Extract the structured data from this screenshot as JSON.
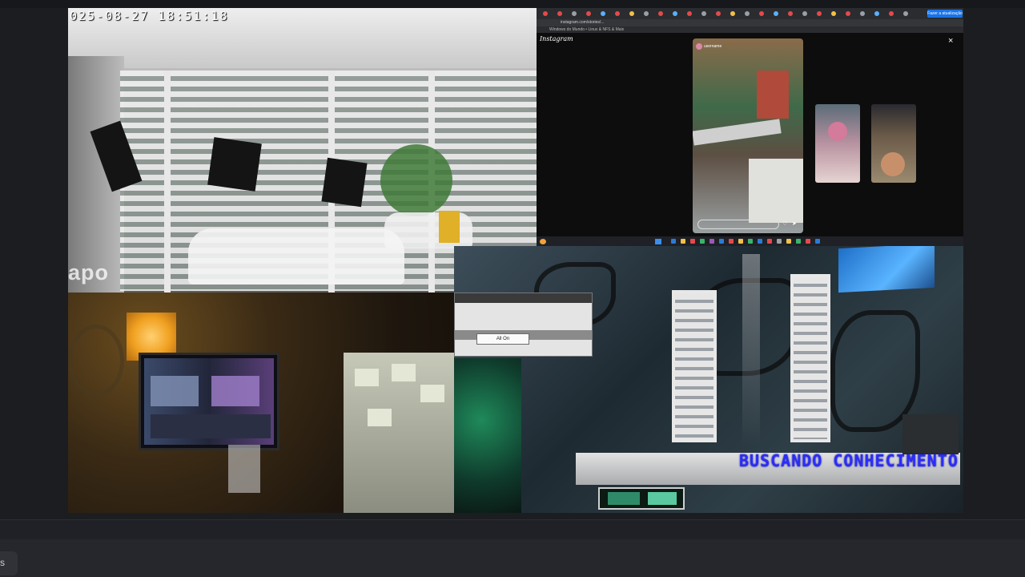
{
  "cameras": {
    "gate": {
      "timestamp": "025-08-27 18:51:18",
      "brand": "apo"
    }
  },
  "browser": {
    "active_tab_label": "Fazer a atualização",
    "url": "instagram.com/stories/...",
    "bookmarks": "Windows do Mundo  •  Linux & NFS & Mais",
    "site_logo": "Instagram",
    "story_user": "username",
    "close_glyph": "×",
    "tab_colors": [
      "#e34a4a",
      "#e34a4a",
      "#9aa0a6",
      "#e34a4a",
      "#5ab0ff",
      "#e34a4a",
      "#f2c04a",
      "#9aa0a6",
      "#e34a4a",
      "#5ab0ff",
      "#e34a4a",
      "#9aa0a6",
      "#e34a4a",
      "#f2c04a",
      "#9aa0a6",
      "#e34a4a",
      "#5ab0ff",
      "#e34a4a",
      "#9aa0a6",
      "#e34a4a",
      "#f2c04a",
      "#e34a4a",
      "#9aa0a6",
      "#5ab0ff",
      "#e34a4a",
      "#9aa0a6"
    ],
    "taskbar_colors": [
      "#2a7bd6",
      "#f2c04a",
      "#e34a4a",
      "#3bb36b",
      "#9b59b6",
      "#2a7bd6",
      "#e34a4a",
      "#f2c04a",
      "#3bb36b",
      "#2a7bd6",
      "#e34a4a",
      "#9aa0a6",
      "#f2c04a",
      "#3bb36b",
      "#e34a4a",
      "#2a7bd6"
    ]
  },
  "dialog": {
    "button_label": "All On"
  },
  "studio": {
    "banner_text": "BUSCANDO CONHECIMENTO"
  },
  "host": {
    "side_tab_label": "s"
  },
  "icons": {
    "close": "close-icon",
    "window": "window-icon"
  }
}
